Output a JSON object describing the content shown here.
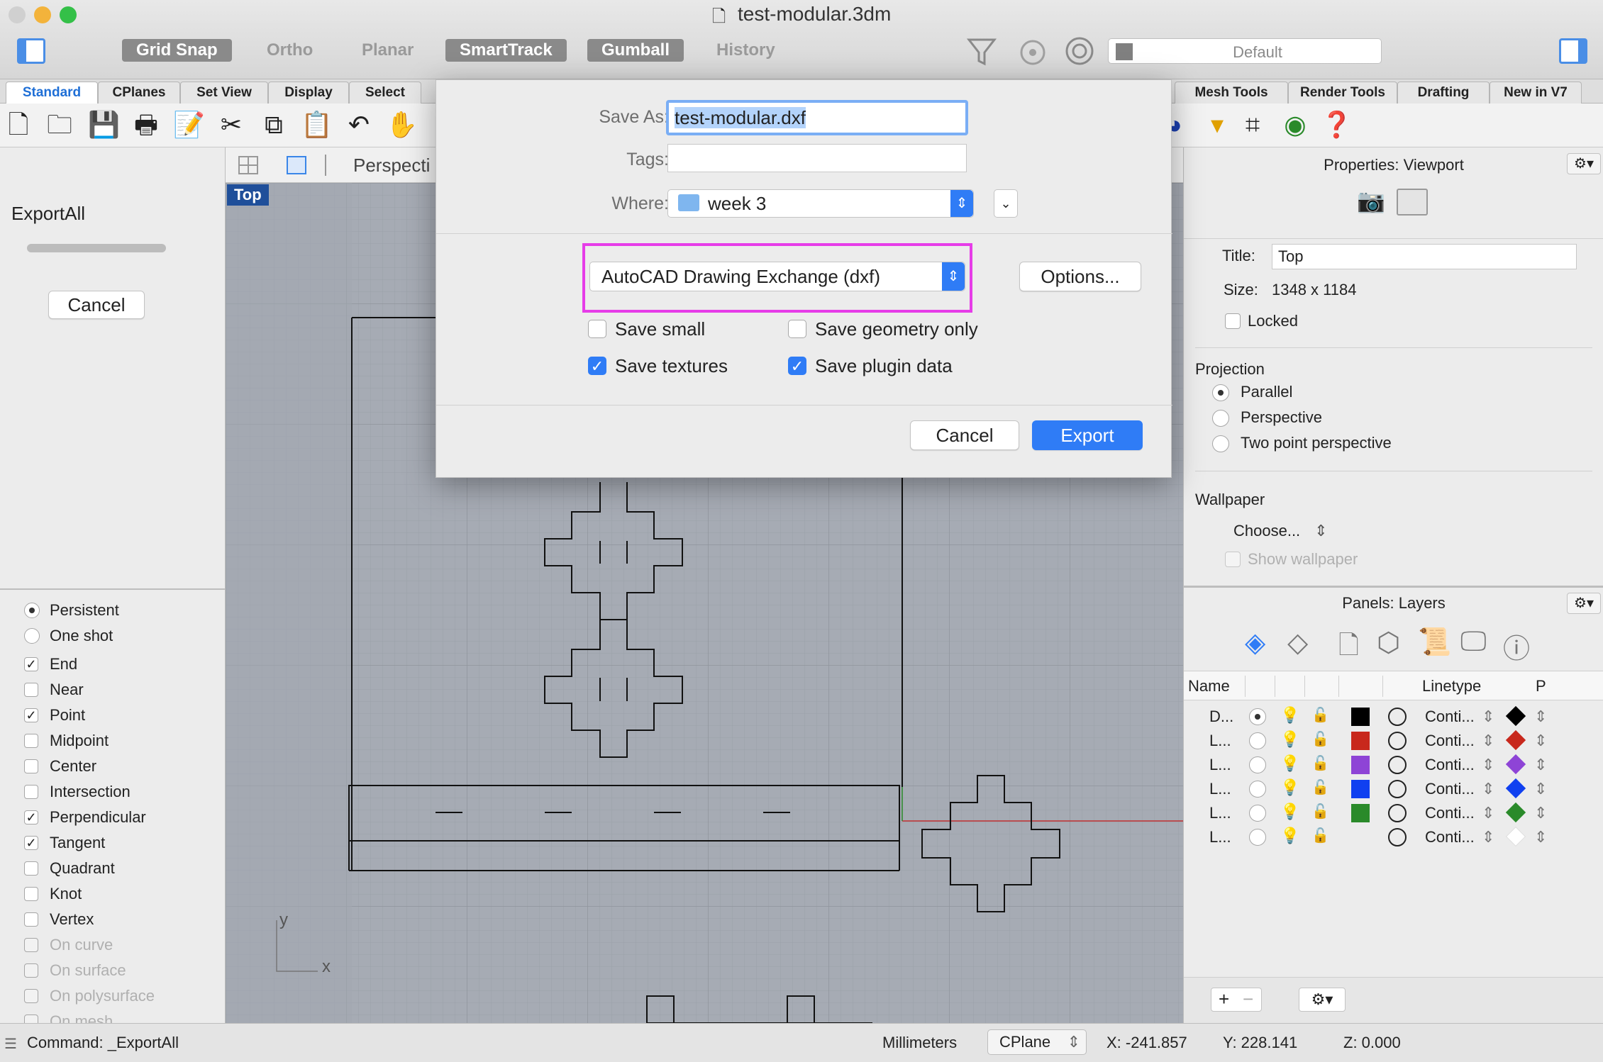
{
  "window": {
    "title": "test-modular.3dm"
  },
  "toolbar": {
    "modes": [
      "Grid Snap",
      "Ortho",
      "Planar",
      "SmartTrack",
      "Gumball",
      "History"
    ],
    "layer_select": "Default"
  },
  "tabs": [
    "Standard",
    "CPlanes",
    "Set View",
    "Display",
    "Select",
    "Mesh Tools",
    "Render Tools",
    "Drafting",
    "New in V7"
  ],
  "left_panel": {
    "command_name": "ExportAll",
    "cancel_label": "Cancel",
    "snap_modes": [
      "Persistent",
      "One shot"
    ],
    "osnaps": [
      {
        "label": "End",
        "checked": true
      },
      {
        "label": "Near",
        "checked": false
      },
      {
        "label": "Point",
        "checked": true
      },
      {
        "label": "Midpoint",
        "checked": false
      },
      {
        "label": "Center",
        "checked": false
      },
      {
        "label": "Intersection",
        "checked": false
      },
      {
        "label": "Perpendicular",
        "checked": true
      },
      {
        "label": "Tangent",
        "checked": true
      },
      {
        "label": "Quadrant",
        "checked": false
      },
      {
        "label": "Knot",
        "checked": false
      },
      {
        "label": "Vertex",
        "checked": false
      },
      {
        "label": "On curve",
        "checked": false
      },
      {
        "label": "On surface",
        "checked": false
      },
      {
        "label": "On polysurface",
        "checked": false
      },
      {
        "label": "On mesh",
        "checked": false
      }
    ]
  },
  "viewport": {
    "tab_label": "Perspecti",
    "name": "Top",
    "axis_x": "x",
    "axis_y": "y"
  },
  "dialog": {
    "save_as_label": "Save As:",
    "save_as_value": "test-modular.dxf",
    "tags_label": "Tags:",
    "where_label": "Where:",
    "where_value": "week 3",
    "format": "AutoCAD Drawing Exchange (dxf)",
    "options_label": "Options...",
    "checkboxes": [
      {
        "label": "Save small",
        "checked": false
      },
      {
        "label": "Save geometry only",
        "checked": false
      },
      {
        "label": "Save textures",
        "checked": true
      },
      {
        "label": "Save plugin data",
        "checked": true
      }
    ],
    "cancel_label": "Cancel",
    "export_label": "Export",
    "highlight_color": "#e63ce8",
    "accent_color": "#2f7cf6"
  },
  "properties": {
    "header": "Properties: Viewport",
    "title_label": "Title:",
    "title_value": "Top",
    "size_label": "Size:",
    "size_value": "1348 x 1184",
    "locked_label": "Locked",
    "projection_label": "Projection",
    "projection_options": [
      "Parallel",
      "Perspective",
      "Two point perspective"
    ],
    "projection_selected": "Parallel",
    "wallpaper_label": "Wallpaper",
    "wallpaper_choose": "Choose...",
    "show_wallpaper": "Show wallpaper"
  },
  "layers": {
    "header": "Panels: Layers",
    "col_name": "Name",
    "col_linetype": "Linetype",
    "col_p": "P",
    "rows": [
      {
        "name": "D...",
        "current": true,
        "color": "#000000",
        "linetype": "Conti...",
        "print_color": "#000000"
      },
      {
        "name": "L...",
        "current": false,
        "color": "#c8281c",
        "linetype": "Conti...",
        "print_color": "#c8281c"
      },
      {
        "name": "L...",
        "current": false,
        "color": "#8e44d6",
        "linetype": "Conti...",
        "print_color": "#8e44d6"
      },
      {
        "name": "L...",
        "current": false,
        "color": "#1040f0",
        "linetype": "Conti...",
        "print_color": "#1040f0"
      },
      {
        "name": "L...",
        "current": false,
        "color": "#2a8a2a",
        "linetype": "Conti...",
        "print_color": "#2a8a2a"
      },
      {
        "name": "L...",
        "current": false,
        "color": "",
        "linetype": "Conti...",
        "print_color": ""
      }
    ]
  },
  "status": {
    "command": "Command: _ExportAll",
    "units": "Millimeters",
    "cplane": "CPlane",
    "x": "X: -241.857",
    "y": "Y: 228.141",
    "z": "Z: 0.000"
  }
}
